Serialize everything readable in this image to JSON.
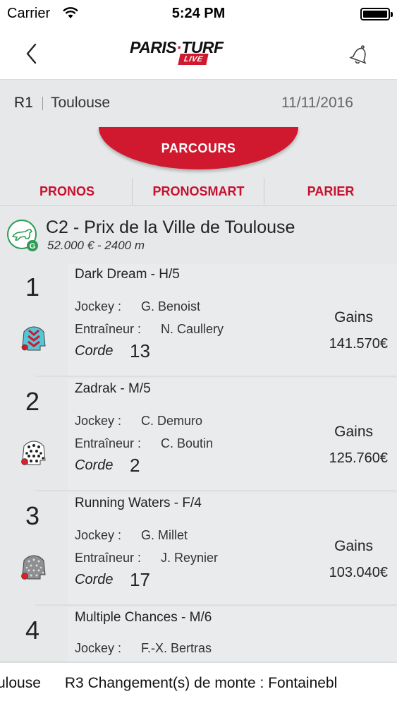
{
  "status_bar": {
    "carrier": "Carrier",
    "time": "5:24 PM"
  },
  "nav": {
    "logo_main": "PARIS",
    "logo_accent": "TURF",
    "logo_badge": "LIVE",
    "back_icon": "chevron-left-icon",
    "alert_icon": "bell-icon"
  },
  "race": {
    "reunion": "R1",
    "city": "Toulouse",
    "date": "11/11/2016"
  },
  "parcours_label": "PARCOURS",
  "tabs": [
    {
      "label": "PRONOS"
    },
    {
      "label": "PRONOSMART"
    },
    {
      "label": "PARIER"
    }
  ],
  "course": {
    "title": "C2 - Prix de la Ville de Toulouse",
    "subtitle": "52.000 € - 2400 m",
    "badge": "G"
  },
  "labels": {
    "jockey": "Jockey :",
    "trainer": "Entraîneur :",
    "corde": "Corde",
    "gains": "Gains"
  },
  "runners": [
    {
      "number": "1",
      "name": "Dark Dream - H/5",
      "jockey": "G. Benoist",
      "trainer": "N. Caullery",
      "corde": "13",
      "gains": "141.570€"
    },
    {
      "number": "2",
      "name": "Zadrak - M/5",
      "jockey": "C. Demuro",
      "trainer": "C. Boutin",
      "corde": "2",
      "gains": "125.760€"
    },
    {
      "number": "3",
      "name": "Running Waters - F/4",
      "jockey": "G. Millet",
      "trainer": "J. Reynier",
      "corde": "17",
      "gains": "103.040€"
    },
    {
      "number": "4",
      "name": "Multiple Chances - M/6",
      "jockey": "F.-X. Bertras"
    }
  ],
  "ticker": {
    "item1": "ulouse",
    "item2": "R3 Changement(s) de monte : Fontainebl"
  },
  "colors": {
    "brand_red": "#d0192e",
    "background": "#e6e8e9",
    "green": "#2e9b56"
  }
}
